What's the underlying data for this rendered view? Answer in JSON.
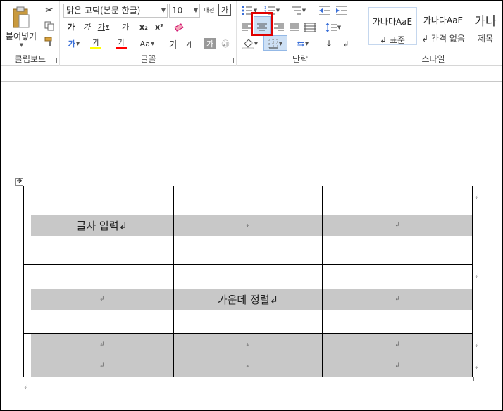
{
  "ribbon": {
    "clipboard": {
      "label": "클립보드",
      "paste_label": "붙여넣기"
    },
    "font": {
      "label": "글꼴",
      "font_name": "맑은 고딕(본문 한글)",
      "font_size": "10",
      "phonetic_glyph": "내천",
      "change_case_glyph": "가",
      "bold": "가",
      "italic": "가",
      "underline": "가",
      "strike": "가",
      "subscript": "x₂",
      "superscript": "x²",
      "text_effect": "가",
      "highlight": "가",
      "font_color": "가",
      "aa": "Aa",
      "grow": "가",
      "shrink": "가",
      "char_shade": "가",
      "enclose": "㉑",
      "accent_colors": {
        "highlight": "#ffff00",
        "font_color": "#ff0000"
      }
    },
    "paragraph": {
      "label": "단락"
    },
    "styles": {
      "label": "스타일",
      "items": [
        {
          "sample": "가나다AaE",
          "name": "↲ 표준"
        },
        {
          "sample": "가나다AaE",
          "name": "↲ 간격 없음"
        },
        {
          "sample": "가나",
          "name": "제목"
        }
      ]
    }
  },
  "document": {
    "rows": [
      [
        "글자 입력↲",
        "↲",
        "↲"
      ],
      [
        "↲",
        "가운데 정렬↲",
        "↲"
      ],
      [
        "↲",
        "↲",
        "↲"
      ],
      [
        "↲",
        "↲",
        "↲"
      ]
    ],
    "end_marks": [
      "↲",
      "↲",
      "↲",
      "↲"
    ],
    "para_mark": "↲",
    "move_handle": "✥"
  },
  "colors": {
    "cell_shading": "#c8c8c8",
    "highlight_outline": "#e00000",
    "ribbon_bg": "#ffffff"
  }
}
